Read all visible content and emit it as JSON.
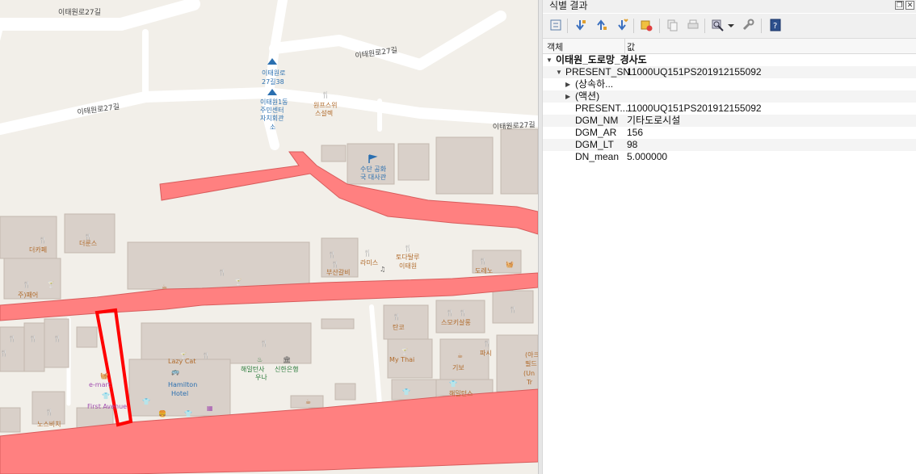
{
  "map": {
    "road_labels": [
      "이태원로27길",
      "이태원로27길",
      "이태원로27길",
      "이태원로27길"
    ],
    "pois": {
      "station_1": "이태원로",
      "station_1b": "27길38",
      "center_1": "이태원1동",
      "center_2": "주민센터",
      "center_3": "자치회관",
      "center_4": "소",
      "rest_1": "원프스위",
      "rest_2": "스설렉",
      "embassy_1": "수단 공화",
      "embassy_2": "국 대사관",
      "cafe_1": "더카페",
      "cafe_2": "더룬스",
      "bar_1": "주)패어",
      "rami": "라미스",
      "tota_1": "토다탈루",
      "tota_2": "이태원",
      "busan": "부산갈비",
      "dare": "도레노",
      "lazy": "Lazy Cat",
      "hamilton_1": "Hamilton",
      "hamilton_2": "Hotel",
      "emart": "e-mart",
      "first": "First Avenue",
      "hamilton_shop_1": "해밀턴사",
      "hamilton_shop_2": "우나",
      "bank": "신한은행",
      "mythai": "My Thai",
      "tanco": "탄코",
      "hasi": "파시",
      "kibo": "기보",
      "hamilton_bar": "해밀턴스",
      "nosuchi": "노스비치",
      "lepere": "스모키살롱",
      "ufc_1": "(아크)",
      "ufc_2": "필드",
      "ufc_3": "(Un",
      "ufc_4": "Tr"
    }
  },
  "panel": {
    "title": "식별 결과",
    "columns": {
      "feature": "객체",
      "value": "값"
    },
    "rows": [
      {
        "indent": 0,
        "expander": "▼",
        "name": "이태원_도로망_경사도",
        "value": "",
        "bold": true
      },
      {
        "indent": 1,
        "expander": "▼",
        "name": "PRESENT_SN",
        "value": "11000UQ151PS201912155092",
        "bold": false
      },
      {
        "indent": 2,
        "expander": "▶",
        "name": "(상속하...",
        "value": "",
        "bold": false
      },
      {
        "indent": 2,
        "expander": "▶",
        "name": "(액션)",
        "value": "",
        "bold": false
      },
      {
        "indent": 2,
        "expander": "",
        "name": "PRESENT...",
        "value": "11000UQ151PS201912155092",
        "bold": false
      },
      {
        "indent": 2,
        "expander": "",
        "name": "DGM_NM",
        "value": "기타도로시설",
        "bold": false
      },
      {
        "indent": 2,
        "expander": "",
        "name": "DGM_AR",
        "value": "156",
        "bold": false
      },
      {
        "indent": 2,
        "expander": "",
        "name": "DGM_LT",
        "value": "98",
        "bold": false
      },
      {
        "indent": 2,
        "expander": "",
        "name": "DN_mean",
        "value": "5.000000",
        "bold": false
      }
    ],
    "icons": [
      "expand-tree-icon",
      "expand-all-icon",
      "collapse-all-icon",
      "expand-new-icon",
      "clear-results-icon",
      "copy-feature-icon",
      "print-icon",
      "identify-mode-icon",
      "dropdown-icon",
      "settings-icon",
      "help-icon"
    ]
  }
}
